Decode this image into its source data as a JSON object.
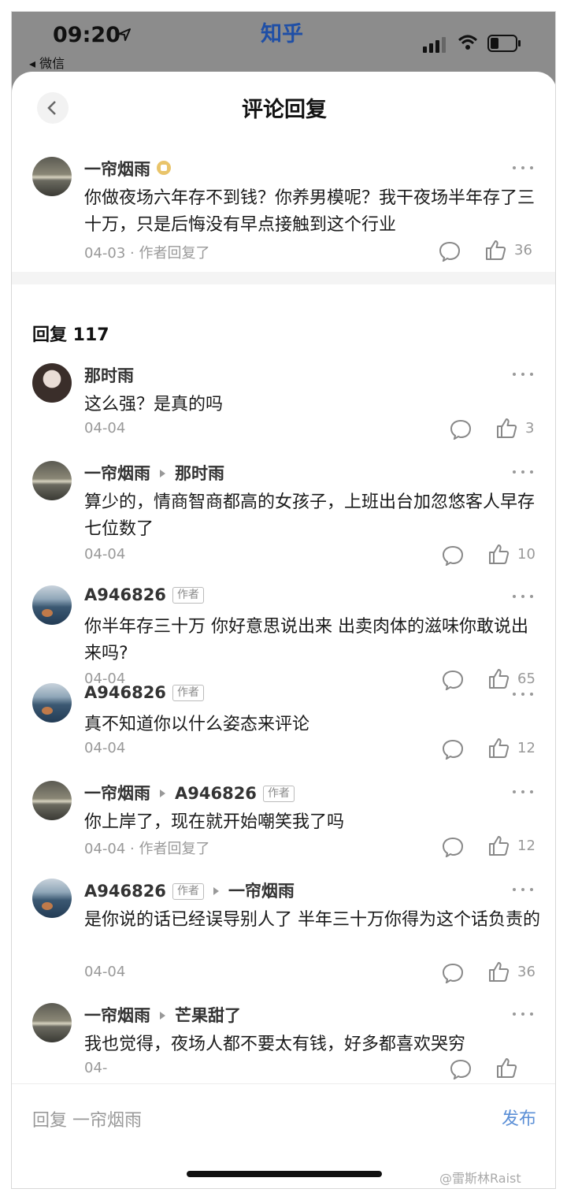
{
  "status_bar": {
    "time": "09:20",
    "back_app": "◂ 微信",
    "app_brand": "知乎"
  },
  "nav": {
    "title": "评论回复"
  },
  "main_comment": {
    "author": "一帘烟雨",
    "text": "你做夜场六年存不到钱？你养男模呢？我干夜场半年存了三十万，只是后悔没有早点接触到这个行业",
    "meta": "04-03 · 作者回复了",
    "likes": "36"
  },
  "replies_header": "回复 117",
  "author_tag": "作者",
  "replies": [
    {
      "author": "那时雨",
      "reply_to": "",
      "author_tag": false,
      "to_tag": false,
      "text": "这么强？是真的吗",
      "meta": "04-04",
      "likes": "3"
    },
    {
      "author": "一帘烟雨",
      "reply_to": "那时雨",
      "author_tag": false,
      "to_tag": false,
      "text": "算少的，情商智商都高的女孩子，上班出台加忽悠客人早存七位数了",
      "meta": "04-04",
      "likes": "10"
    },
    {
      "author": "A946826",
      "reply_to": "",
      "author_tag": true,
      "to_tag": false,
      "text": "你半年存三十万 你好意思说出来 出卖肉体的滋味你敢说出来吗?",
      "meta": "04-04",
      "likes": "65"
    },
    {
      "author": "A946826",
      "reply_to": "",
      "author_tag": true,
      "to_tag": false,
      "text": "真不知道你以什么姿态来评论",
      "meta": "04-04",
      "likes": "12"
    },
    {
      "author": "一帘烟雨",
      "reply_to": "A946826",
      "author_tag": false,
      "to_tag": true,
      "text": "你上岸了，现在就开始嘲笑我了吗",
      "meta": "04-04 · 作者回复了",
      "likes": "12"
    },
    {
      "author": "A946826",
      "reply_to": "一帘烟雨",
      "author_tag": true,
      "to_tag": false,
      "text": "是你说的话已经误导别人了 半年三十万你得为这个话负责的",
      "meta": "04-04",
      "likes": "36"
    },
    {
      "author": "一帘烟雨",
      "reply_to": "芒果甜了",
      "author_tag": false,
      "to_tag": false,
      "text": "我也觉得，夜场人都不要太有钱，好多都喜欢哭穷",
      "meta": "04-",
      "likes": ""
    }
  ],
  "bottom_bar": {
    "input_placeholder": "回复 一帘烟雨",
    "post_label": "发布"
  },
  "watermark": "@雷斯林Raist"
}
